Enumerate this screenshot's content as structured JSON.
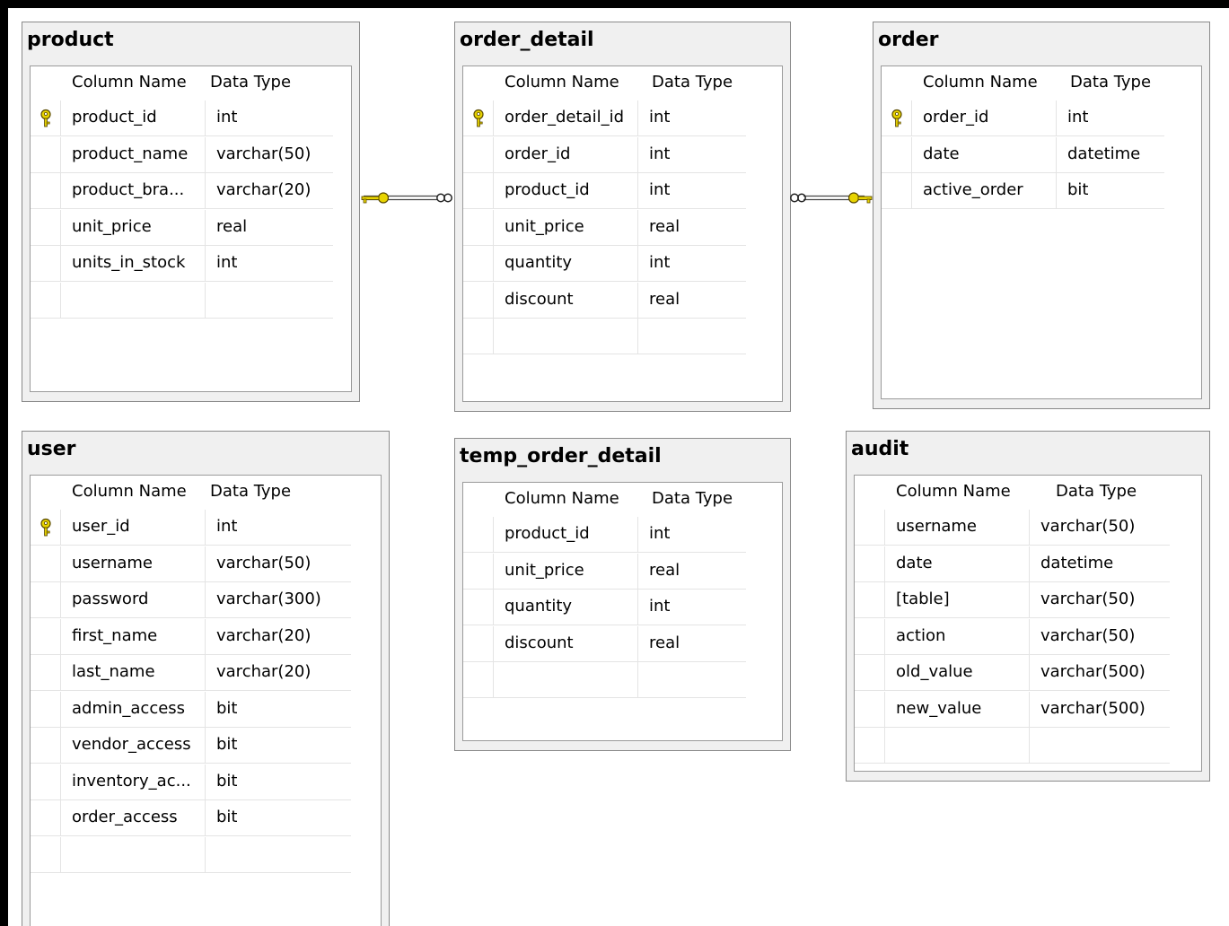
{
  "columns_header": {
    "name": "Column Name",
    "type": "Data Type"
  },
  "tables": {
    "product": {
      "title": "product",
      "rows": [
        {
          "name": "product_id",
          "type": "int",
          "key": true
        },
        {
          "name": "product_name",
          "type": "varchar(50)"
        },
        {
          "name": "product_bra...",
          "type": "varchar(20)"
        },
        {
          "name": "unit_price",
          "type": "real"
        },
        {
          "name": "units_in_stock",
          "type": "int"
        },
        {
          "name": "",
          "type": ""
        }
      ]
    },
    "order_detail": {
      "title": "order_detail",
      "rows": [
        {
          "name": "order_detail_id",
          "type": "int",
          "key": true
        },
        {
          "name": "order_id",
          "type": "int"
        },
        {
          "name": "product_id",
          "type": "int"
        },
        {
          "name": "unit_price",
          "type": "real"
        },
        {
          "name": "quantity",
          "type": "int"
        },
        {
          "name": "discount",
          "type": "real"
        },
        {
          "name": "",
          "type": ""
        }
      ]
    },
    "order": {
      "title": "order",
      "rows": [
        {
          "name": "order_id",
          "type": "int",
          "key": true
        },
        {
          "name": "date",
          "type": "datetime"
        },
        {
          "name": "active_order",
          "type": "bit"
        }
      ]
    },
    "user": {
      "title": "user",
      "rows": [
        {
          "name": "user_id",
          "type": "int",
          "key": true
        },
        {
          "name": "username",
          "type": "varchar(50)"
        },
        {
          "name": "password",
          "type": "varchar(300)"
        },
        {
          "name": "first_name",
          "type": "varchar(20)"
        },
        {
          "name": "last_name",
          "type": "varchar(20)"
        },
        {
          "name": "admin_access",
          "type": "bit"
        },
        {
          "name": "vendor_access",
          "type": "bit"
        },
        {
          "name": "inventory_ac...",
          "type": "bit"
        },
        {
          "name": "order_access",
          "type": "bit"
        },
        {
          "name": "",
          "type": ""
        }
      ]
    },
    "temp_order_detail": {
      "title": "temp_order_detail",
      "rows": [
        {
          "name": "product_id",
          "type": "int"
        },
        {
          "name": "unit_price",
          "type": "real"
        },
        {
          "name": "quantity",
          "type": "int"
        },
        {
          "name": "discount",
          "type": "real"
        },
        {
          "name": "",
          "type": ""
        }
      ]
    },
    "audit": {
      "title": "audit",
      "rows": [
        {
          "name": "username",
          "type": "varchar(50)"
        },
        {
          "name": "date",
          "type": "datetime"
        },
        {
          "name": "[table]",
          "type": "varchar(50)"
        },
        {
          "name": "action",
          "type": "varchar(50)"
        },
        {
          "name": "old_value",
          "type": "varchar(500)"
        },
        {
          "name": "new_value",
          "type": "varchar(500)"
        },
        {
          "name": "",
          "type": ""
        }
      ]
    }
  },
  "relationships": [
    {
      "from": "product",
      "to": "order_detail",
      "one_end": "key-icon",
      "many_end": "infinity-icon"
    },
    {
      "from": "order",
      "to": "order_detail",
      "one_end": "key-icon",
      "many_end": "infinity-icon"
    }
  ],
  "colors": {
    "key": "#e8d400",
    "key_outline": "#5a4a00",
    "frame": "#000000"
  }
}
